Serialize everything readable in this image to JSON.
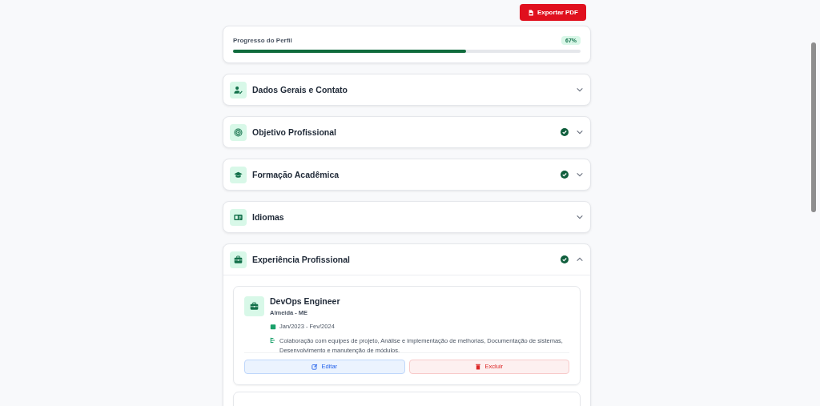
{
  "export_button": {
    "label": "Exportar PDF"
  },
  "progress": {
    "label": "Progresso do Perfil",
    "badge": "67%",
    "level": 0.67
  },
  "sections": [
    {
      "kind": "user",
      "title": "Dados Gerais e Contato",
      "completed": false,
      "expanded": false
    },
    {
      "kind": "target",
      "title": "Objetivo Profissional",
      "completed": true,
      "expanded": false
    },
    {
      "kind": "education",
      "title": "Formação Acadêmica",
      "completed": true,
      "expanded": false
    },
    {
      "kind": "language",
      "title": "Idiomas",
      "completed": false,
      "expanded": false
    },
    {
      "kind": "work",
      "title": "Experiência Profissional",
      "completed": true,
      "expanded": true,
      "entries": [
        {
          "title": "DevOps Engineer",
          "location": "Almeida - ME",
          "period": "Jan/2023 - Fev/2024",
          "description": "Colaboração com equipes de projeto, Análise e implementação de melhorias, Documentação de sistemas, Desenvolvimento e manutenção de módulos.",
          "edit_label": "Editar",
          "delete_label": "Excluir"
        }
      ]
    }
  ]
}
